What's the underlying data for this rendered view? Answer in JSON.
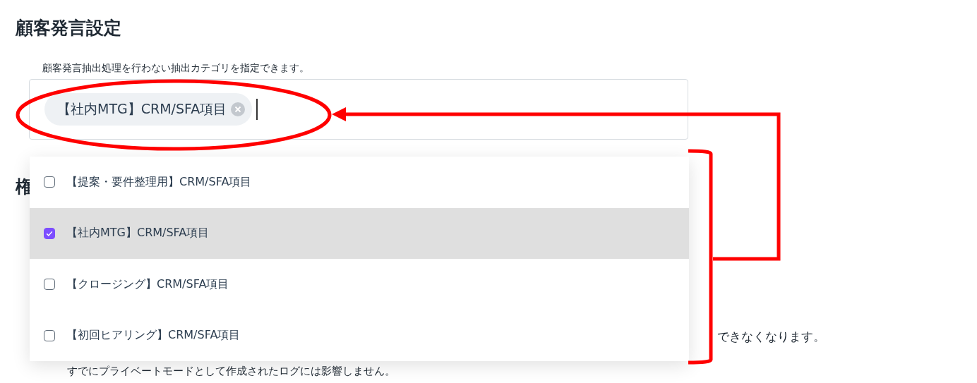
{
  "section": {
    "title": "顧客発言設定",
    "description": "顧客発言抽出処理を行わない抽出カテゴリを指定できます。",
    "chips": [
      {
        "label": "【社内MTG】CRM/SFA項目"
      }
    ]
  },
  "dropdown": {
    "options": [
      {
        "label": "【提案・要件整理用】CRM/SFA項目",
        "checked": false,
        "selected": false
      },
      {
        "label": "【社内MTG】CRM/SFA項目",
        "checked": true,
        "selected": true
      },
      {
        "label": "【クロージング】CRM/SFA項目",
        "checked": false,
        "selected": false
      },
      {
        "label": "【初回ヒアリング】CRM/SFA項目",
        "checked": false,
        "selected": false
      }
    ]
  },
  "background": {
    "heading": "権",
    "note_end": "できなくなります。",
    "note_last": "すでにプライベートモードとして作成されたログには影響しません。"
  }
}
